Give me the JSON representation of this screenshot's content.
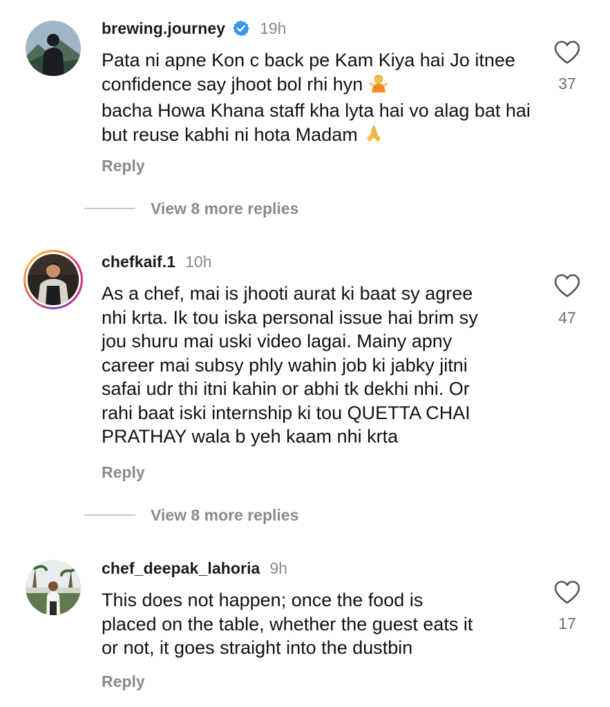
{
  "colors": {
    "verified_badge": "#3897f0",
    "secondary_text": "#8a8a8a",
    "primary_text": "#111111",
    "story_ring": "#e1306c"
  },
  "comments": [
    {
      "username": "brewing.journey",
      "verified": true,
      "time": "19h",
      "text_before_emoji": "Pata ni apne Kon c back pe Kam Kiya hai Jo itnee confidence say jhoot bol rhi hyn",
      "text_after_emoji": "bacha Howa Khana staff kha lyta hai vo alag bat hai but reuse kabhi ni hota Madam",
      "likes": "37",
      "reply_label": "Reply",
      "more_replies": "View 8 more replies",
      "avatar_icon": "person-silhouette-mountains-avatar"
    },
    {
      "username": "chefkaif.1",
      "verified": false,
      "time": "10h",
      "text": "As a chef, mai is jhooti aurat ki baat sy agree\nnhi krta. Ik tou iska personal issue hai brim sy\njou shuru mai uski video lagai. Mainy apny\ncareer mai subsy phly wahin job ki jabky jitni\nsafai udr thi itni kahin or abhi tk dekhi nhi. Or\nrahi baat iski internship ki tou QUETTA CHAI\nPRATHAY wala b yeh kaam nhi krta",
      "likes": "47",
      "reply_label": "Reply",
      "more_replies": "View 8 more replies",
      "avatar_icon": "chef-in-apron-avatar"
    },
    {
      "username": "chef_deepak_lahoria",
      "verified": false,
      "time": "9h",
      "text": "This does not happen; once the food is\nplaced on the table, whether the guest eats it\nor not, it goes straight into the dustbin",
      "likes": "17",
      "reply_label": "Reply",
      "avatar_icon": "chef-outdoor-palm-avatar"
    }
  ]
}
